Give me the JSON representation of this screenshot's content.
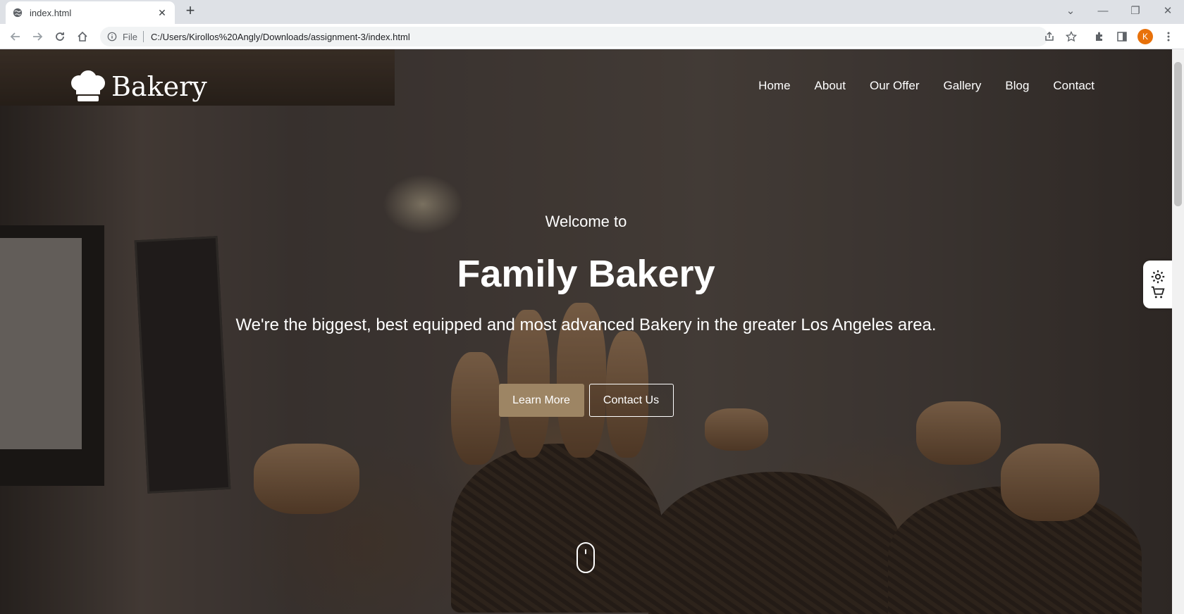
{
  "browser": {
    "tab": {
      "title": "index.html"
    },
    "omnibox": {
      "scheme_label": "File",
      "url": "C:/Users/Kirollos%20Angly/Downloads/assignment-3/index.html"
    },
    "profile_initial": "K"
  },
  "site": {
    "logo_text": "Bakery",
    "nav": [
      "Home",
      "About",
      "Our Offer",
      "Gallery",
      "Blog",
      "Contact"
    ],
    "hero": {
      "welcome": "Welcome to",
      "headline": "Family Bakery",
      "tagline": "We're the biggest, best equipped and most advanced Bakery in the greater Los Angeles area.",
      "primary_button": "Learn More",
      "secondary_button": "Contact Us"
    },
    "colors": {
      "accent": "#9d8564",
      "text": "#ffffff"
    },
    "side_panel_icons": [
      "gear-icon",
      "cart-icon"
    ]
  }
}
